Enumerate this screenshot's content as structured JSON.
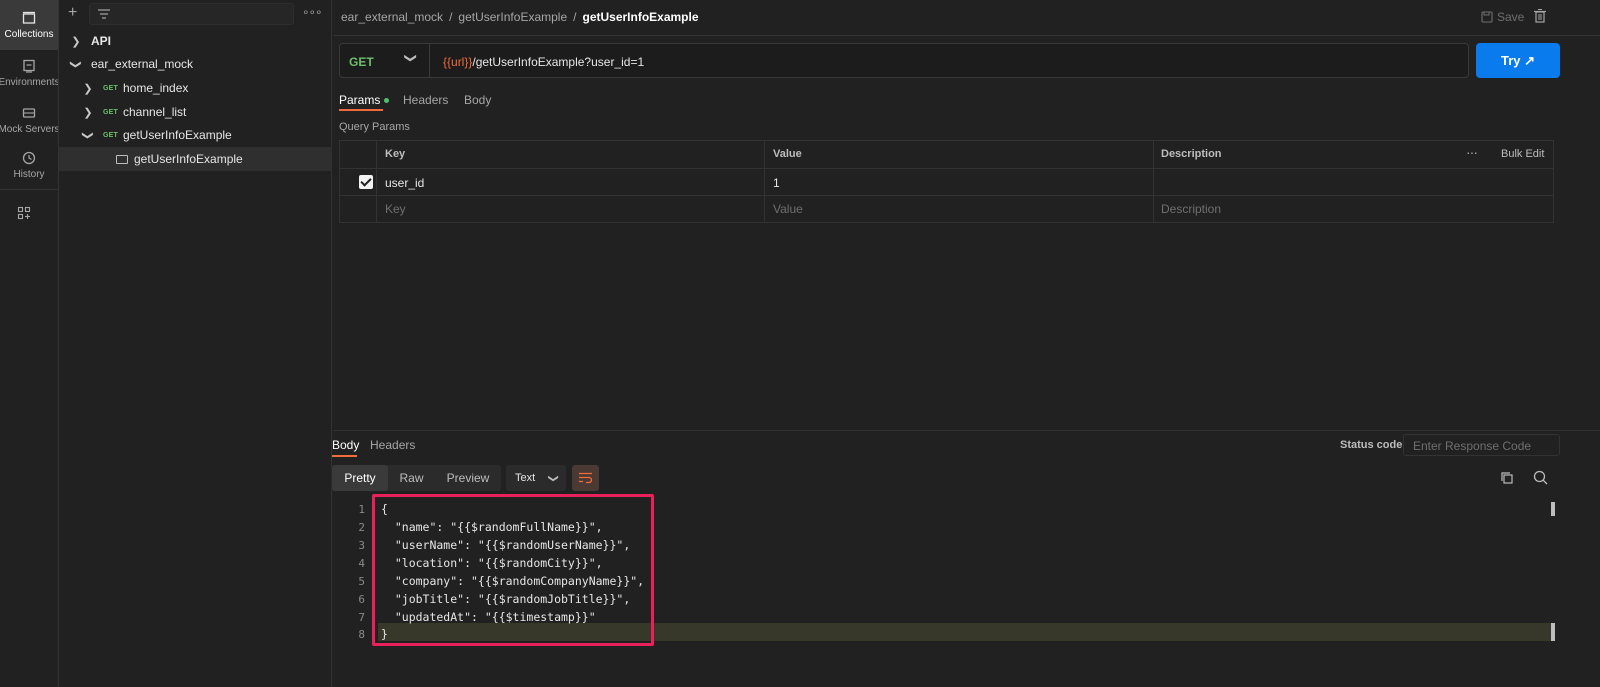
{
  "rail": {
    "items": [
      {
        "label": "Collections",
        "icon": "collections-icon"
      },
      {
        "label": "Environments",
        "icon": "environments-icon"
      },
      {
        "label": "Mock Servers",
        "icon": "mock-servers-icon"
      },
      {
        "label": "History",
        "icon": "history-icon"
      }
    ]
  },
  "sidebar": {
    "tree": [
      {
        "label": "API",
        "chevron": ">"
      },
      {
        "label": "ear_external_mock",
        "chevron": "v"
      },
      {
        "label": "home_index",
        "method": "GET",
        "chevron": ">"
      },
      {
        "label": "channel_list",
        "method": "GET",
        "chevron": ">"
      },
      {
        "label": "getUserInfoExample",
        "method": "GET",
        "chevron": "v"
      },
      {
        "label": "getUserInfoExample"
      }
    ]
  },
  "header": {
    "breadcrumb": [
      "ear_external_mock",
      "/",
      "getUserInfoExample",
      "/",
      "getUserInfoExample"
    ],
    "save_label": "Save"
  },
  "request": {
    "method": "GET",
    "url_var": "{{url}}",
    "url_path": "/getUserInfoExample?user_id=1",
    "try_label": "Try ↗",
    "tabs": [
      "Params",
      "Headers",
      "Body"
    ],
    "section_title": "Query Params",
    "columns": [
      "Key",
      "Value",
      "Description"
    ],
    "bulk_edit": "Bulk Edit",
    "params": [
      {
        "key": "user_id",
        "value": "1",
        "description": "",
        "checked": true
      }
    ],
    "placeholders": {
      "key": "Key",
      "value": "Value",
      "description": "Description"
    }
  },
  "response": {
    "tabs": [
      "Body",
      "Headers"
    ],
    "status_code_label": "Status code",
    "status_code_placeholder": "Enter Response Code",
    "modes": [
      "Pretty",
      "Raw",
      "Preview"
    ],
    "format": "Text",
    "code_lines": [
      "{",
      "  \"name\": \"{{$randomFullName}}\",",
      "  \"userName\": \"{{$randomUserName}}\",",
      "  \"location\": \"{{$randomCity}}\",",
      "  \"company\": \"{{$randomCompanyName}}\",",
      "  \"jobTitle\": \"{{$randomJobTitle}}\",",
      "  \"updatedAt\": \"{{$timestamp}}\"",
      "}"
    ],
    "line_numbers": [
      "1",
      "2",
      "3",
      "4",
      "5",
      "6",
      "7",
      "8"
    ]
  },
  "colors": {
    "accent": "#f26b3a",
    "primary_button": "#097bed",
    "highlight": "#e8215b",
    "get_method": "#6bbf6b"
  }
}
